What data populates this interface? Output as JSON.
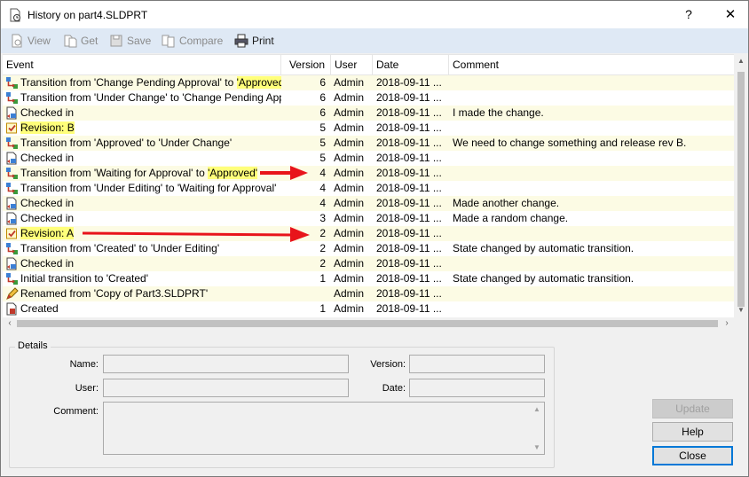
{
  "window": {
    "title": "History on part4.SLDPRT",
    "help_glyph": "?",
    "close_glyph": "✕"
  },
  "toolbar": {
    "view": "View",
    "get": "Get",
    "save": "Save",
    "compare": "Compare",
    "print": "Print"
  },
  "columns": {
    "event": "Event",
    "version": "Version",
    "user": "User",
    "date": "Date",
    "comment": "Comment"
  },
  "rows": [
    {
      "icon": "transition-icon",
      "event_pre": "Transition from 'Change Pending Approval' to ",
      "event_hl": "'Approved'",
      "version": "6",
      "user": "Admin",
      "date": "2018-09-11 ...",
      "comment": ""
    },
    {
      "icon": "transition-icon",
      "event_pre": "Transition from 'Under Change' to 'Change Pending Appro...",
      "event_hl": "",
      "version": "6",
      "user": "Admin",
      "date": "2018-09-11 ...",
      "comment": ""
    },
    {
      "icon": "checkin-icon",
      "event_pre": "Checked in",
      "event_hl": "",
      "version": "6",
      "user": "Admin",
      "date": "2018-09-11 ...",
      "comment": "I made the change."
    },
    {
      "icon": "revision-icon",
      "event_pre": "",
      "event_hl": "Revision: B",
      "version": "5",
      "user": "Admin",
      "date": "2018-09-11 ...",
      "comment": ""
    },
    {
      "icon": "transition-icon",
      "event_pre": "Transition from 'Approved' to 'Under Change'",
      "event_hl": "",
      "version": "5",
      "user": "Admin",
      "date": "2018-09-11 ...",
      "comment": "We need to change something and release rev B."
    },
    {
      "icon": "checkin-icon",
      "event_pre": "Checked in",
      "event_hl": "",
      "version": "5",
      "user": "Admin",
      "date": "2018-09-11 ...",
      "comment": ""
    },
    {
      "icon": "transition-icon",
      "event_pre": "Transition from 'Waiting for Approval' to ",
      "event_hl": "'Approved'",
      "version": "4",
      "user": "Admin",
      "date": "2018-09-11 ...",
      "comment": ""
    },
    {
      "icon": "transition-icon",
      "event_pre": "Transition from 'Under Editing' to 'Waiting for Approval'",
      "event_hl": "",
      "version": "4",
      "user": "Admin",
      "date": "2018-09-11 ...",
      "comment": ""
    },
    {
      "icon": "checkin-icon",
      "event_pre": "Checked in",
      "event_hl": "",
      "version": "4",
      "user": "Admin",
      "date": "2018-09-11 ...",
      "comment": "Made another change."
    },
    {
      "icon": "checkin-icon",
      "event_pre": "Checked in",
      "event_hl": "",
      "version": "3",
      "user": "Admin",
      "date": "2018-09-11 ...",
      "comment": "Made a random change."
    },
    {
      "icon": "revision-icon",
      "event_pre": "",
      "event_hl": "Revision: A",
      "version": "2",
      "user": "Admin",
      "date": "2018-09-11 ...",
      "comment": ""
    },
    {
      "icon": "transition-icon",
      "event_pre": "Transition from 'Created' to 'Under Editing'",
      "event_hl": "",
      "version": "2",
      "user": "Admin",
      "date": "2018-09-11 ...",
      "comment": "State changed by automatic transition."
    },
    {
      "icon": "checkin-icon",
      "event_pre": "Checked in",
      "event_hl": "",
      "version": "2",
      "user": "Admin",
      "date": "2018-09-11 ...",
      "comment": ""
    },
    {
      "icon": "transition-icon",
      "event_pre": "Initial transition to 'Created'",
      "event_hl": "",
      "version": "1",
      "user": "Admin",
      "date": "2018-09-11 ...",
      "comment": "State changed by automatic transition."
    },
    {
      "icon": "rename-icon",
      "event_pre": "Renamed from 'Copy of Part3.SLDPRT'",
      "event_hl": "",
      "version": "",
      "user": "Admin",
      "date": "2018-09-11 ...",
      "comment": ""
    },
    {
      "icon": "created-icon",
      "event_pre": "Created",
      "event_hl": "",
      "version": "1",
      "user": "Admin",
      "date": "2018-09-11 ...",
      "comment": ""
    }
  ],
  "details": {
    "group_label": "Details",
    "name_label": "Name:",
    "version_label": "Version:",
    "user_label": "User:",
    "date_label": "Date:",
    "comment_label": "Comment:",
    "name_value": "",
    "version_value": "",
    "user_value": "",
    "date_value": "",
    "comment_value": ""
  },
  "buttons": {
    "update": "Update",
    "help": "Help",
    "close": "Close"
  },
  "colors": {
    "highlight": "#ffff7a",
    "arrow": "#e8141b",
    "toolbar_bg": "#dfe9f5",
    "alt_row": "#fcfbe4",
    "default_button_border": "#0078d7"
  }
}
